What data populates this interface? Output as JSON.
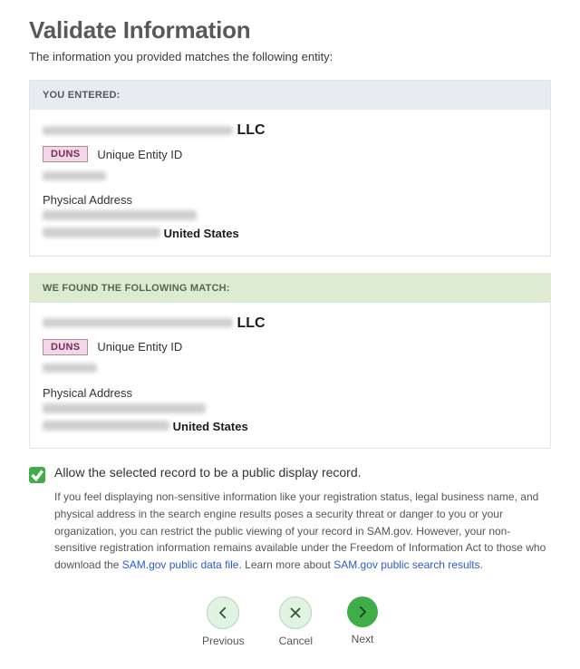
{
  "title": "Validate Information",
  "subtitle": "The information you provided matches the following entity:",
  "entered": {
    "header": "YOU ENTERED:",
    "entity_suffix": "LLC",
    "duns_badge": "DUNS",
    "uei_label": "Unique Entity ID",
    "addr_label": "Physical Address",
    "addr_country": "United States"
  },
  "match": {
    "header": "WE FOUND THE FOLLOWING MATCH:",
    "entity_suffix": "LLC",
    "duns_badge": "DUNS",
    "uei_label": "Unique Entity ID",
    "addr_label": "Physical Address",
    "addr_country": "United States"
  },
  "consent": {
    "checked": true,
    "label": "Allow the selected record to be a public display record.",
    "help": "If you feel displaying non-sensitive information like your registration status, legal business name, and physical address in the search engine results poses a security threat or danger to you or your organization, you can restrict the public viewing of your record in SAM.gov. However, your non-sensitive registration information remains available under the Freedom of Information Act to those who download the ",
    "link1": "SAM.gov public data file",
    "help2": ". Learn more about ",
    "link2": "SAM.gov public search results",
    "help3": "."
  },
  "nav": {
    "previous": "Previous",
    "cancel": "Cancel",
    "next": "Next"
  }
}
